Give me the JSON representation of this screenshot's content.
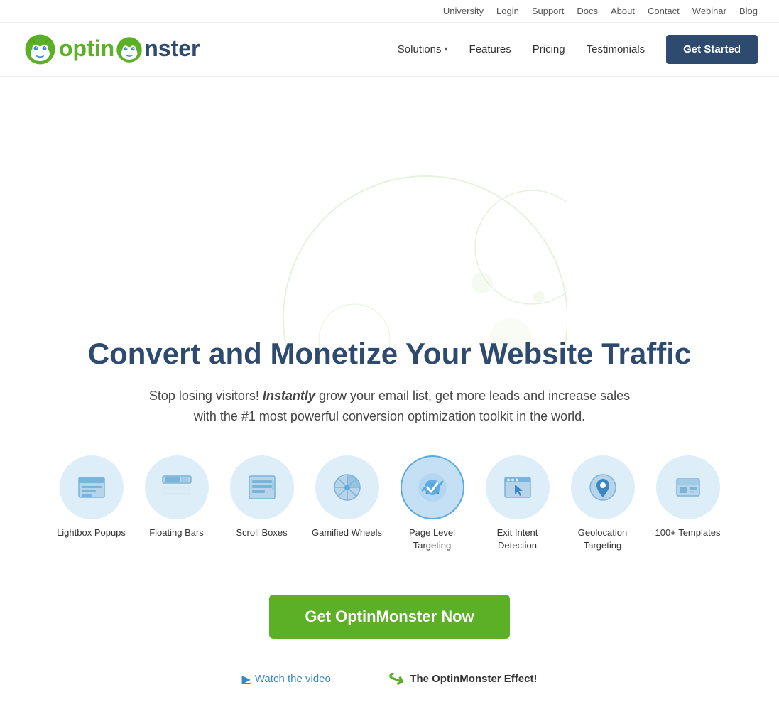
{
  "top_nav": {
    "links": [
      {
        "label": "University",
        "name": "university-link"
      },
      {
        "label": "Login",
        "name": "login-link"
      },
      {
        "label": "Support",
        "name": "support-link"
      },
      {
        "label": "Docs",
        "name": "docs-link"
      },
      {
        "label": "About",
        "name": "about-link"
      },
      {
        "label": "Contact",
        "name": "contact-link"
      },
      {
        "label": "Webinar",
        "name": "webinar-link"
      },
      {
        "label": "Blog",
        "name": "blog-link"
      }
    ]
  },
  "main_nav": {
    "solutions_label": "Solutions",
    "features_label": "Features",
    "pricing_label": "Pricing",
    "testimonials_label": "Testimonials",
    "get_started_label": "Get Started"
  },
  "hero": {
    "title": "Convert and Monetize Your Website Traffic",
    "subtitle_plain": "Stop losing visitors! ",
    "subtitle_italic": "Instantly",
    "subtitle_rest": " grow your email list, get more leads and increase sales with the #1 most powerful conversion optimization toolkit in the world."
  },
  "features": [
    {
      "label": "Lightbox Popups",
      "icon_type": "lightbox"
    },
    {
      "label": "Floating Bars",
      "icon_type": "floating_bars"
    },
    {
      "label": "Scroll Boxes",
      "icon_type": "scroll_boxes"
    },
    {
      "label": "Gamified Wheels",
      "icon_type": "gamified"
    },
    {
      "label": "Page Level Targeting",
      "icon_type": "page_level",
      "active": true
    },
    {
      "label": "Exit Intent Detection",
      "icon_type": "exit_intent"
    },
    {
      "label": "Geolocation Targeting",
      "icon_type": "geolocation"
    },
    {
      "label": "100+ Templates",
      "icon_type": "templates"
    }
  ],
  "cta": {
    "button_label": "Get OptinMonster Now"
  },
  "watch_video": {
    "label": "Watch the video"
  },
  "effect_label": "The OptinMonster Effect!"
}
